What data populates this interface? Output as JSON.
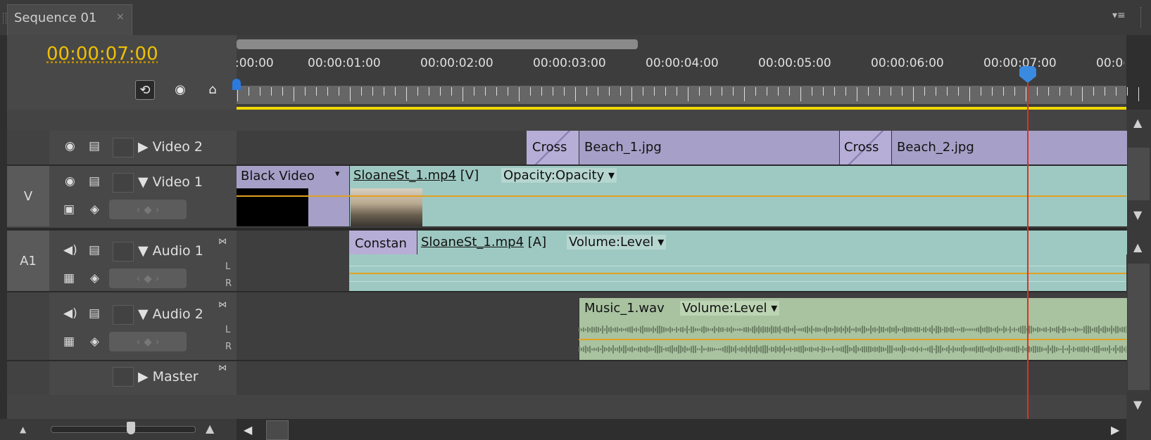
{
  "tab": {
    "title": "Sequence 01",
    "close": "×"
  },
  "panel_menu": "▾≡",
  "timecode": "00:00:07:00",
  "ruler": {
    "labels": [
      ":00:00",
      "00:00:01:00",
      "00:00:02:00",
      "00:00:03:00",
      "00:00:04:00",
      "00:00:05:00",
      "00:00:06:00",
      "00:00:07:00",
      "00:0("
    ]
  },
  "tracks": {
    "video2": {
      "name": "Video 2"
    },
    "video1": {
      "name": "Video 1",
      "tag": "V"
    },
    "audio1": {
      "name": "Audio 1",
      "tag": "A1",
      "l": "L",
      "r": "R"
    },
    "audio2": {
      "name": "Audio 2",
      "l": "L",
      "r": "R"
    },
    "master": {
      "name": "Master"
    }
  },
  "clips": {
    "cross1": "Cross",
    "beach1": "Beach_1.jpg",
    "cross2": "Cross",
    "beach2": "Beach_2.jpg",
    "black_video": "Black Video",
    "sloane_v": "SloaneSt_1.mp4",
    "sloane_v_suffix": "[V]",
    "opacity": "Opacity:Opacity",
    "constant": "Constan",
    "sloane_a": "SloaneSt_1.mp4",
    "sloane_a_suffix": "[A]",
    "volume1": "Volume:Level",
    "music": "Music_1.wav",
    "volume2": "Volume:Level"
  },
  "colors": {
    "timecode": "#f0c000",
    "playhead": "#e03020",
    "video_clip": "#a6a0c8",
    "audio_clip": "#9ec9c2",
    "music_clip": "#a9c2a0"
  }
}
